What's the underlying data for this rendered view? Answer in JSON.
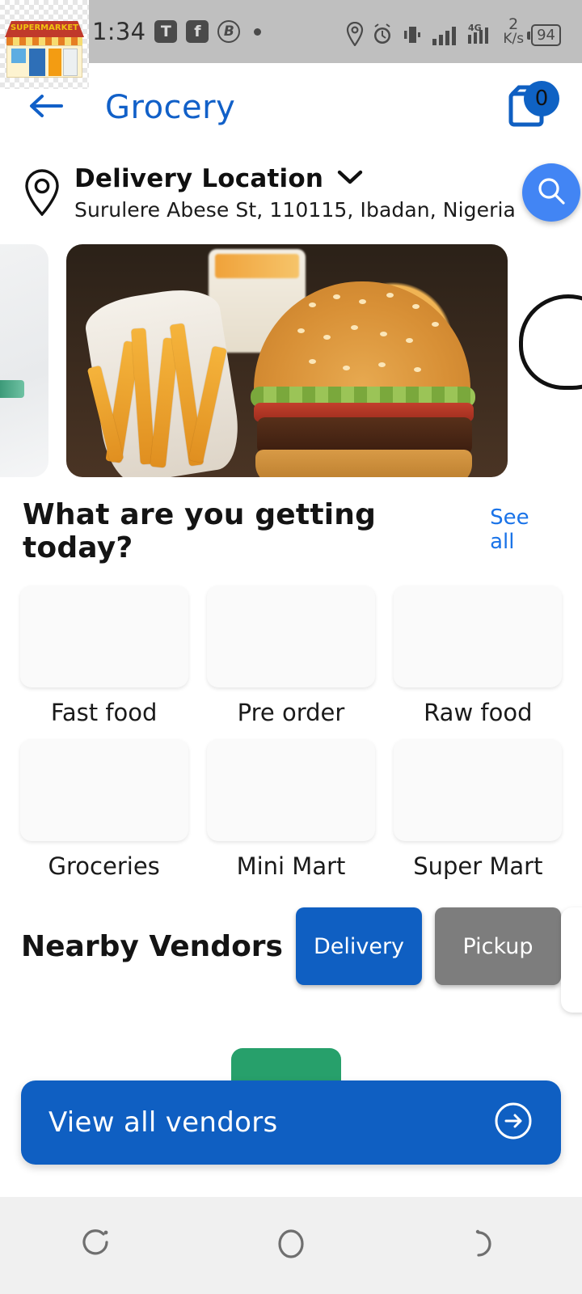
{
  "status_bar": {
    "time": "1:34",
    "icons_left": [
      "t-badge-icon",
      "facebook-icon",
      "bitcoin-circle-icon",
      "dot-indicator-icon"
    ],
    "t_badge": "T",
    "b_badge": "B",
    "icons_right": [
      "location-pin-icon",
      "alarm-icon",
      "vibrate-icon",
      "signal-bars-icon",
      "network-4g-icon"
    ],
    "network_type": "4G",
    "data_rate_value": "2",
    "data_rate_unit": "K/s",
    "battery_level": "94"
  },
  "app_bar": {
    "back_icon": "arrow-left-icon",
    "title": "Grocery",
    "cart_icon": "shopping-bag-icon",
    "cart_count": "0"
  },
  "delivery": {
    "pin_icon": "location-pin-icon",
    "label": "Delivery Location",
    "chevron_icon": "chevron-down-icon",
    "address": "Surulere Abese St, 110115, Ibadan, Nigeria",
    "search_icon": "search-icon"
  },
  "carousel": {
    "slides": [
      {
        "alt": "promo-card-left-partial"
      },
      {
        "alt": "burger-and-fries-banner"
      },
      {
        "alt": "promo-card-right-partial"
      }
    ],
    "active_index": 1
  },
  "categories_section": {
    "title": "What are you getting today?",
    "see_all": "See all",
    "items": [
      {
        "label": "Fast food",
        "image": "fast-food-tray-image"
      },
      {
        "label": "Pre order",
        "image": "pre-order-stamp-image"
      },
      {
        "label": "Raw food",
        "image": "vegetable-basket-image"
      },
      {
        "label": "Groceries",
        "image": "grocery-basket-image"
      },
      {
        "label": "Mini Mart",
        "image": "mini-market-storefront-image"
      },
      {
        "label": "Super Mart",
        "image": "supermarket-storefront-image"
      }
    ]
  },
  "vendors_section": {
    "title": "Nearby Vendors",
    "toggle": {
      "delivery_label": "Delivery",
      "pickup_label": "Pickup",
      "selected": "Delivery"
    }
  },
  "cta": {
    "label": "View all vendors",
    "arrow_icon": "arrow-right-circle-icon"
  },
  "nav_bar": {
    "recents_icon": "recents-icon",
    "home_icon": "home-circle-icon",
    "back_icon": "back-arc-icon"
  },
  "colors": {
    "brand_blue": "#0f5fc2",
    "title_blue": "#1160c8",
    "link_blue": "#1a73e8",
    "search_blue": "#4285f4",
    "inactive_gray": "#7d7d7d",
    "status_bar_gray": "#bfbfbf",
    "nav_bar_gray": "#f0f0f0",
    "vendor_green": "#27a06b"
  }
}
